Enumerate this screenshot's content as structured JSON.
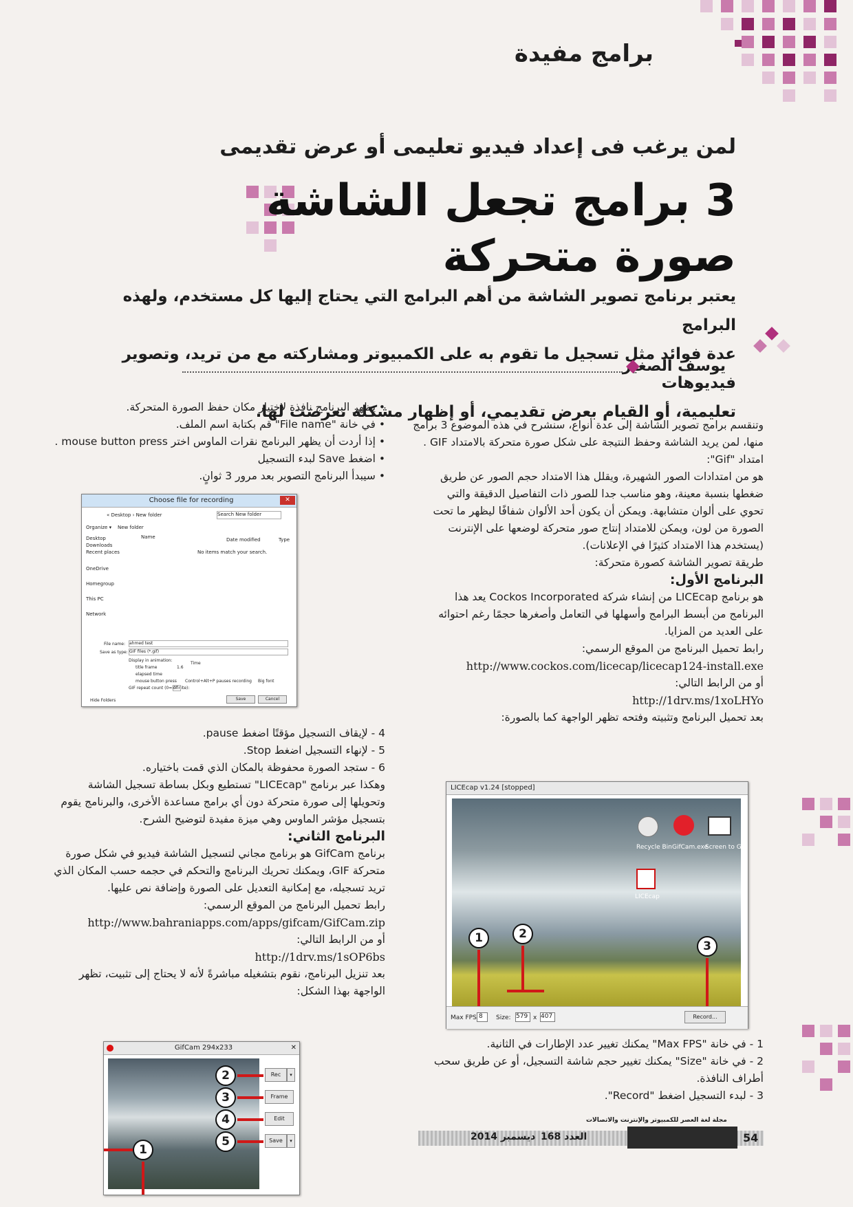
{
  "header": {
    "section_label": "برامج مفيدة",
    "subtitle": "لمن يرغب فى إعداد فيديو تعليمى أو عرض تقديمى",
    "title_line1": "3 برامج تجعل الشاشة",
    "title_line2": "صورة متحركة"
  },
  "intro": {
    "lines": [
      "يعتبر برنامج تصوير الشاشة من أهم البرامج التي يحتاج إليها كل مستخدم، ولهذه البرامج",
      "عدة فوائد مثل تسجيل ما تقوم به على الكمبيوتر ومشاركته مع من تريد، وتصوير فيديوهات",
      "تعليمية، أو القيام بعرض تقديمي، أو إظهار مشكلة تعرضت لها."
    ],
    "author": "يوسف الصغير"
  },
  "right_col": {
    "para1": [
      "وتنقسم برامج تصوير الشاشة إلى عدة أنواع، سنشرح في هذه الموضوع 3 برامج",
      "منها، لمن يريد الشاشة وحفظ النتيجة على شكل صورة متحركة بالامتداد GIF .",
      "امتداد \"Gif\":",
      "هو من امتدادات الصور الشهيرة، ويقلل هذا الامتداد حجم الصور عن طريق",
      "ضغطها بنسبة معينة، وهو مناسب جدا للصور ذات التفاصيل الدقيقة والتي",
      "تحوي على ألوان متشابهة. ويمكن أن يكون أحد الألوان شفافًا ليظهر ما تحت",
      "الصورة من لون، ويمكن للامتداد إنتاج صور متحركة لوضعها على الإنترنت",
      "(يستخدم هذا الامتداد كثيرًا في الإعلانات).",
      "طريقة تصوير الشاشة كصورة متحركة:"
    ],
    "heading1": "البرنامج الأول:",
    "para2": [
      "هو برنامج LICEcap من إنشاء شركة Cockos Incorporated يعد هذا",
      "البرنامج من أبسط البرامج وأسهلها في التعامل وأصغرها حجمًا رغم احتوائه",
      "على العديد من المزايا.",
      "رابط تحميل البرنامج من الموقع الرسمي:"
    ],
    "url1": "http://www.cockos.com/licecap/licecap124-install.exe",
    "alt_link_label": "أو من الرابط التالي:",
    "url2": "http://1drv.ms/1xoLHYo",
    "after_download": "بعد تحميل البرنامج وتثبيته وفتحه تظهر الواجهة كما بالصورة:",
    "steps": [
      "1 - في خانة \"Max FPS\" يمكنك تغيير عدد الإطارات في الثانية.",
      "2 - في خانة \"Size\" يمكنك تغيير حجم شاشة التسجيل، أو عن طريق سحب",
      "أطراف النافذة.",
      "3 - لبدء التسجيل اضغط \"Record\"."
    ]
  },
  "licecap": {
    "title": "LICEcap v1.24 [stopped]",
    "maxfps_label": "Max FPS:",
    "maxfps_value": "8",
    "size_label": "Size:",
    "size_w": "579",
    "size_x": "x",
    "size_h": "407",
    "record_label": "Record...",
    "icon1": "Recycle Bin",
    "icon2": "GifCam.exe",
    "icon3": "Screen to Gif",
    "icon4": "LICEcap",
    "markers": [
      "1",
      "2",
      "3"
    ]
  },
  "left_col": {
    "bullets": [
      "• يظهر البرنامج نافذة لاختيار مكان حفظ الصورة المتحركة.",
      "• في خانة \"File name\" قم بكتابة اسم الملف.",
      "• إذا أردت أن يظهر البرنامج نقرات الماوس اختر mouse button press .",
      "• اضغط Save لبدء التسجيل",
      "• سيبدأ البرنامج التصوير بعد مرور 3 ثوانٍ."
    ],
    "steps": [
      "4 - لإيقاف التسجيل مؤقتًا اضغط pause.",
      "5 - لإنهاء التسجيل اضغط Stop.",
      "6 - ستجد الصورة محفوظة بالمكان الذي قمت باختياره."
    ],
    "summary": [
      "وهكذا عبر برنامج \"LICEcap\" تستطيع وبكل بساطة تسجيل الشاشة",
      "وتحويلها إلى صورة متحركة دون أي برامج مساعدة الأخرى، والبرنامج يقوم",
      "بتسجيل مؤشر الماوس وهي ميزة مفيدة لتوضيح الشرح."
    ],
    "heading2": "البرنامج الثاني:",
    "para": [
      "برنامج GifCam هو برنامج مجاني لتسجيل الشاشة فيديو في شكل صورة",
      "متحركة GIF، ويمكنك تحريك البرنامج والتحكم في حجمه حسب المكان الذي",
      "تريد تسجيله، مع إمكانية التعديل على الصورة وإضافة نص عليها.",
      "رابط تحميل البرنامج من الموقع الرسمي:"
    ],
    "url1": "http://www.bahraniapps.com/apps/gifcam/GifCam.zip",
    "alt_link_label": "أو من الرابط التالي:",
    "url2": "http://1drv.ms/1sOP6bs",
    "after": [
      "بعد تنزيل البرنامج، نقوم بتشغيله مباشرةً لأنه لا يحتاج إلى تثبيت، تظهر",
      "الواجهة بهذا الشكل:"
    ]
  },
  "save_dialog": {
    "title": "Choose file for recording",
    "breadcrumb": "« Desktop › New folder",
    "search": "Search New folder",
    "organize": "Organize ▾",
    "new_folder": "New folder",
    "col_name": "Name",
    "col_date": "Date modified",
    "col_type": "Type",
    "empty": "No items match your search.",
    "sidebar": [
      "Desktop",
      "Downloads",
      "Recent places",
      "OneDrive",
      "Homegroup",
      "This PC",
      "Network"
    ],
    "file_name_label": "File name:",
    "file_name_value": "ahmed test",
    "save_type_label": "Save as type:",
    "save_type_value": "GIF files (*.gif)",
    "display_label": "Display in animation:",
    "opt_title": "title frame",
    "opt_elapsed": "elapsed time",
    "opt_mouse": "mouse button press",
    "opt_ctrl": "Control+Alt+P pauses recording",
    "opt_big": "Big font",
    "repeat_label": "GIF repeat count (0=infinite):",
    "repeat_value": "0",
    "hide_folders": "Hide Folders",
    "save_btn": "Save",
    "cancel_btn": "Cancel",
    "value_1": "1.6",
    "value_time": "Time"
  },
  "gifcam": {
    "title": "GifCam 294x233",
    "rec": "Rec",
    "frame": "Frame",
    "edit": "Edit",
    "save": "Save",
    "markers": [
      "2",
      "3",
      "4",
      "5",
      "1"
    ]
  },
  "footer": {
    "page": "54",
    "magazine": "مجلة لغة العصر للكمبيوتر والإنترنت والاتصالات",
    "issue": "العدد 168",
    "date": "ديسمبر 2014"
  },
  "colors": {
    "accent": "#b0307d",
    "pattern_dark": "#8f2566",
    "pattern_mid": "#c97aac",
    "pattern_light": "#e3c3d7",
    "arrow": "#d01818"
  }
}
